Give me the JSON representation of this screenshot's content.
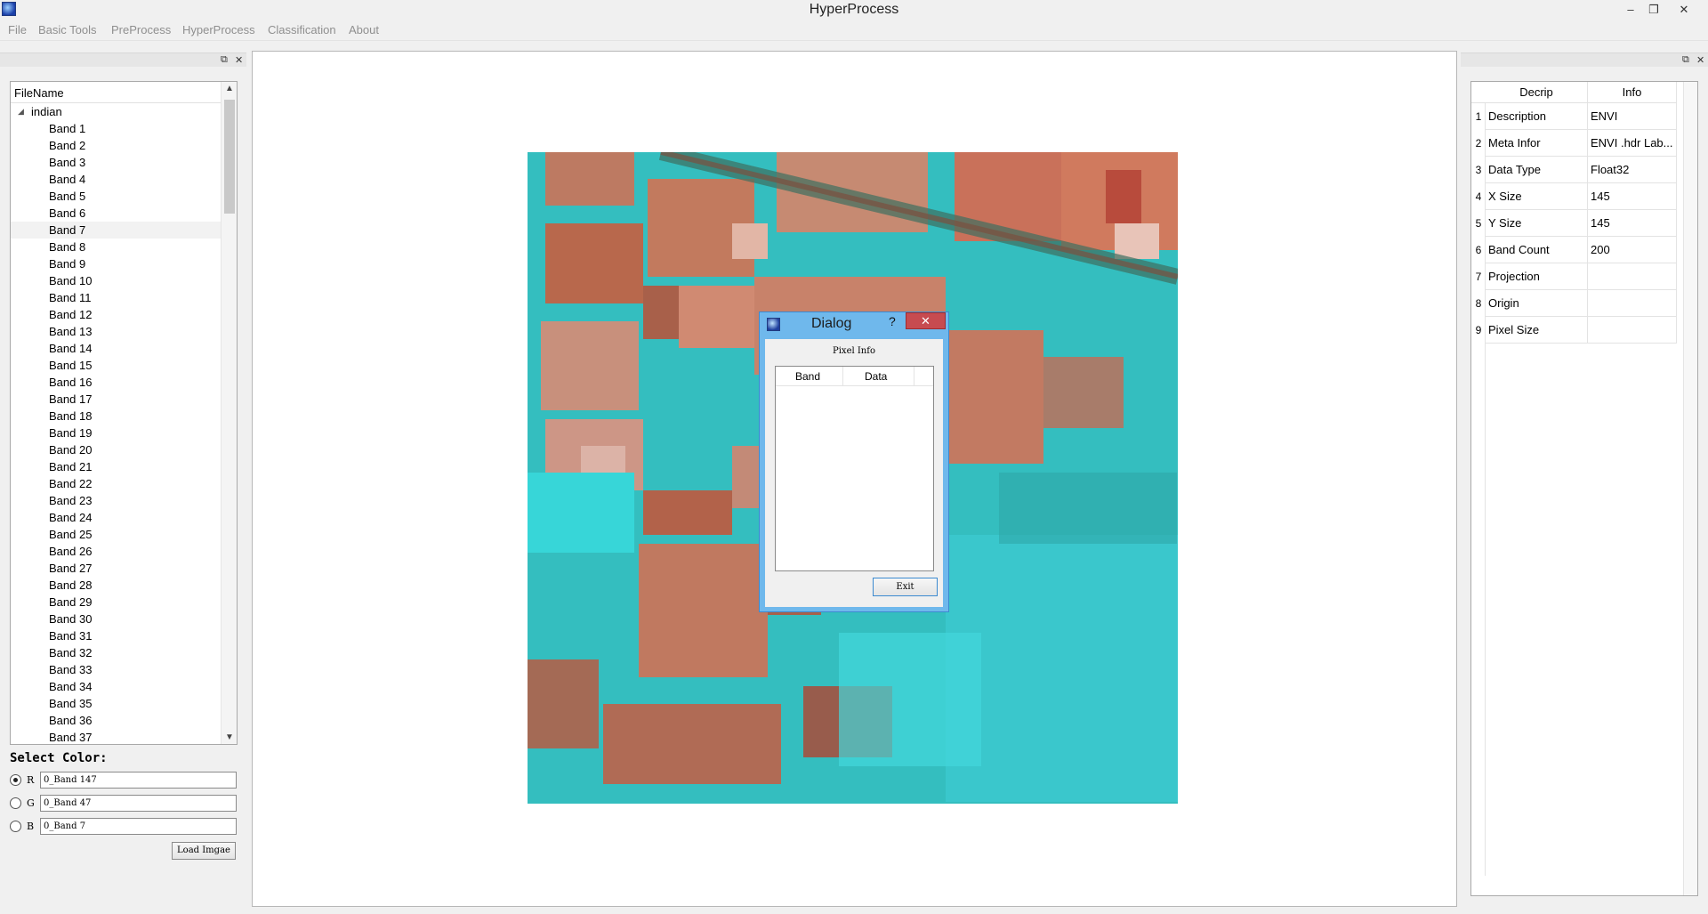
{
  "window": {
    "title": "HyperProcess",
    "minimize": "–",
    "restore": "❐",
    "close": "✕"
  },
  "menu": [
    "File",
    "Basic Tools",
    "PreProcess",
    "HyperProcess",
    "Classification",
    "About"
  ],
  "dock": {
    "float": "⧉",
    "close": "✕"
  },
  "file_tree": {
    "header": "FileName",
    "root": "indian",
    "selected": "Band 7",
    "items": [
      "Band 1",
      "Band 2",
      "Band 3",
      "Band 4",
      "Band 5",
      "Band 6",
      "Band 7",
      "Band 8",
      "Band 9",
      "Band 10",
      "Band 11",
      "Band 12",
      "Band 13",
      "Band 14",
      "Band 15",
      "Band 16",
      "Band 17",
      "Band 18",
      "Band 19",
      "Band 20",
      "Band 21",
      "Band 22",
      "Band 23",
      "Band 24",
      "Band 25",
      "Band 26",
      "Band 27",
      "Band 28",
      "Band 29",
      "Band 30",
      "Band 31",
      "Band 32",
      "Band 33",
      "Band 34",
      "Band 35",
      "Band 36",
      "Band 37"
    ]
  },
  "select_color": {
    "title": "Select Color:",
    "channels": [
      {
        "label": "R",
        "value": "0_Band 147",
        "checked": true
      },
      {
        "label": "G",
        "value": "0_Band 47",
        "checked": false
      },
      {
        "label": "B",
        "value": "0_Band 7",
        "checked": false
      }
    ],
    "load_button": "Load Imgae"
  },
  "dialog": {
    "title": "Dialog",
    "help": "?",
    "close": "✕",
    "heading": "Pixel Info",
    "columns": [
      "Band",
      "Data"
    ],
    "exit_button": "Exit"
  },
  "info_table": {
    "columns": [
      "Decrip",
      "Info"
    ],
    "rows": [
      {
        "num": "1",
        "decrip": "Description",
        "info": "ENVI"
      },
      {
        "num": "2",
        "decrip": "Meta Infor",
        "info": "ENVI .hdr Lab..."
      },
      {
        "num": "3",
        "decrip": "Data Type",
        "info": "Float32"
      },
      {
        "num": "4",
        "decrip": "X Size",
        "info": "145"
      },
      {
        "num": "5",
        "decrip": "Y Size",
        "info": "145"
      },
      {
        "num": "6",
        "decrip": "Band Count",
        "info": "200"
      },
      {
        "num": "7",
        "decrip": "Projection",
        "info": ""
      },
      {
        "num": "8",
        "decrip": "Origin",
        "info": ""
      },
      {
        "num": "9",
        "decrip": "Pixel Size",
        "info": ""
      }
    ]
  },
  "colors": {
    "image_cyan": "#2fc2c4",
    "image_brown": "#b5664a",
    "dialog_frame": "#6fb8ec",
    "close_red": "#c74b50"
  }
}
